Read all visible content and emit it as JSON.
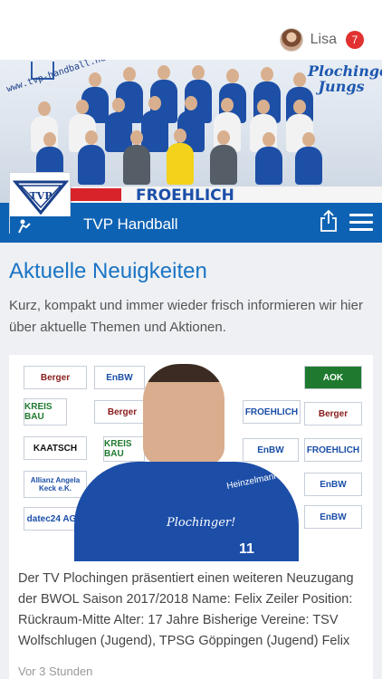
{
  "user": {
    "name": "Lisa",
    "notifications": "7"
  },
  "hero": {
    "url_text": "www.tvp-handball.net",
    "brand_text": "Plochinger! Jungs",
    "sponsor_text": "FROEHLICH"
  },
  "club": {
    "title": "TVP Handball",
    "logo_text": "TVP"
  },
  "page": {
    "title": "Aktuelle Neuigkeiten",
    "intro": "Kurz, kompakt und immer wieder frisch informieren wir hier über aktuelle Themen und Aktionen."
  },
  "news": [
    {
      "sponsor_wall": [
        "Berger",
        "EnBW",
        "KREIS BAU",
        "Berger",
        "FROEHLICH",
        "KAATSCH",
        "KREIS BAU",
        "EnBW",
        "FROEHLICH",
        "Allianz Angela Keck e.K.",
        "EnBW",
        "datec24 AG",
        "EnBW",
        "AOK",
        "Berger",
        "Plochinger!",
        "Heinzelmann"
      ],
      "jersey_number": "11",
      "text": "Der TV Plochingen präsentiert einen weiteren Neuzugang der BWOL Saison 2017/2018 Name: Felix Zeiler Position: Rückraum-Mitte Alter: 17 Jahre Bisherige Vereine: TSV Wolfschlugen (Jugend), TPSG Göppingen (Jugend) Felix",
      "time": "Vor 3 Stunden"
    }
  ],
  "colors": {
    "brand_blue": "#0e62b3",
    "title_blue": "#1a74c4",
    "badge_red": "#e23131"
  }
}
